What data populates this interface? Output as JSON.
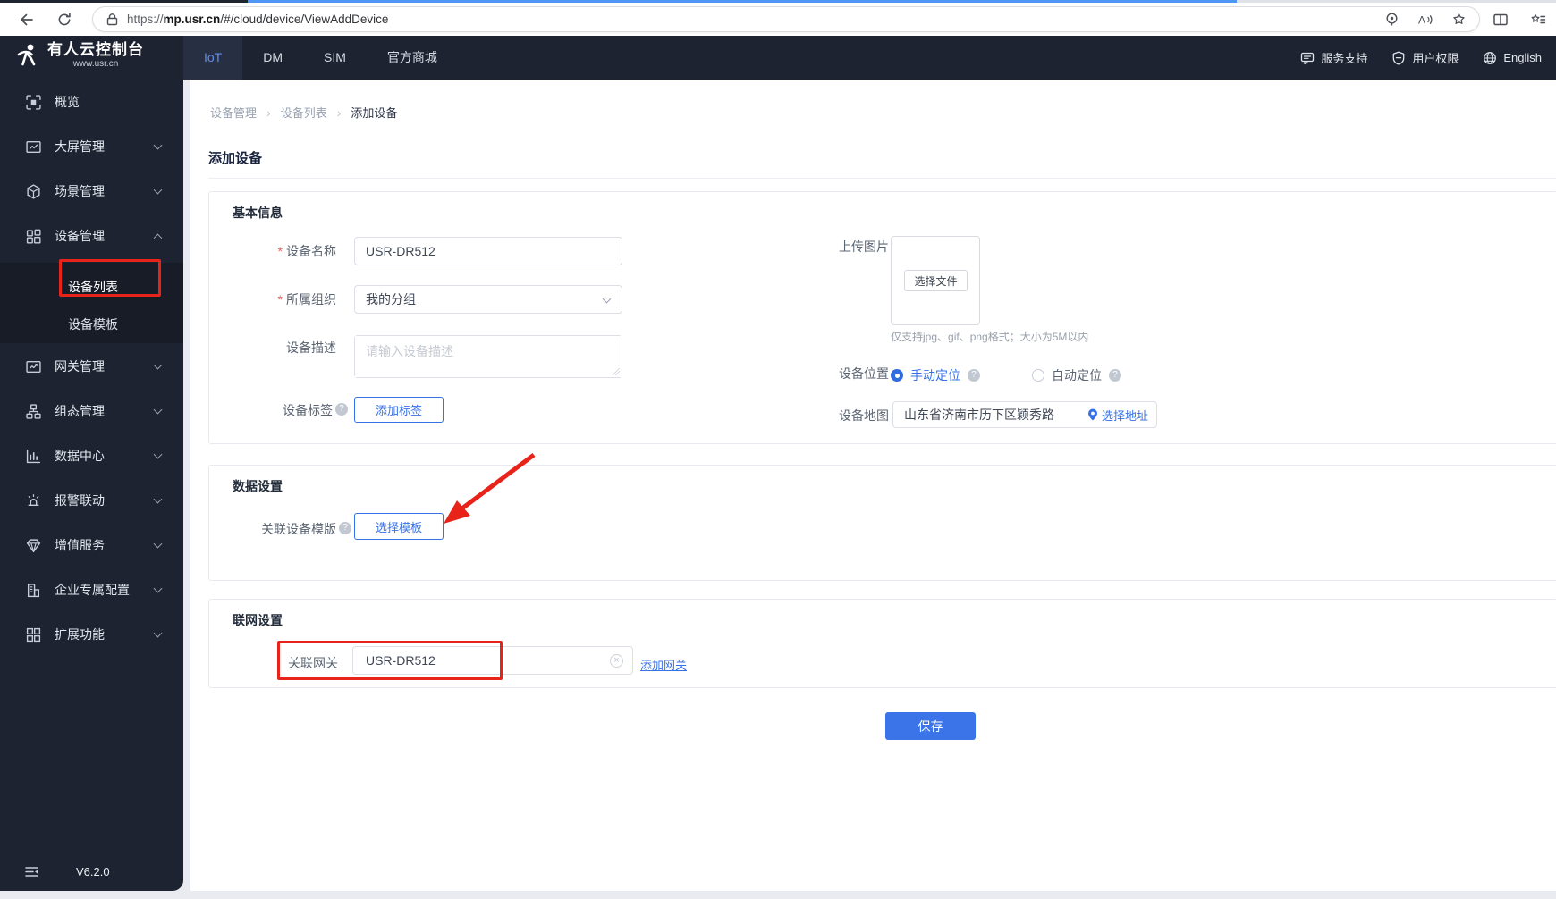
{
  "browser": {
    "url": {
      "scheme": "https://",
      "domain": "mp.usr.cn",
      "path": "/#/cloud/device/ViewAddDevice"
    }
  },
  "topnav": {
    "logo": {
      "title": "有人云控制台",
      "subtitle": "www.usr.cn"
    },
    "tabs": [
      {
        "label": "IoT",
        "active": true
      },
      {
        "label": "DM",
        "active": false
      },
      {
        "label": "SIM",
        "active": false
      },
      {
        "label": "官方商城",
        "active": false
      }
    ],
    "links": [
      {
        "label": "服务支持",
        "icon": "chat-icon"
      },
      {
        "label": "用户权限",
        "icon": "shield-icon"
      },
      {
        "label": "English",
        "icon": "globe-icon"
      }
    ]
  },
  "sidebar": {
    "items": [
      {
        "label": "概览",
        "icon": "overview-icon"
      },
      {
        "label": "大屏管理",
        "icon": "bigscreen-icon"
      },
      {
        "label": "场景管理",
        "icon": "scene-icon"
      },
      {
        "label": "设备管理",
        "icon": "device-icon",
        "expanded": true,
        "children": [
          {
            "label": "设备列表",
            "active": true
          },
          {
            "label": "设备模板",
            "active": false
          }
        ]
      },
      {
        "label": "网关管理",
        "icon": "gateway-icon"
      },
      {
        "label": "组态管理",
        "icon": "scada-icon"
      },
      {
        "label": "数据中心",
        "icon": "datacenter-icon"
      },
      {
        "label": "报警联动",
        "icon": "alarm-icon"
      },
      {
        "label": "增值服务",
        "icon": "vas-icon"
      },
      {
        "label": "企业专属配置",
        "icon": "enterprise-icon"
      },
      {
        "label": "扩展功能",
        "icon": "extension-icon"
      }
    ],
    "version": "V6.2.0"
  },
  "breadcrumb": {
    "items": [
      "设备管理",
      "设备列表",
      "添加设备"
    ],
    "separator": "›"
  },
  "page": {
    "title": "添加设备"
  },
  "form": {
    "basic": {
      "title": "基本信息",
      "device_name": {
        "label": "设备名称",
        "required": true,
        "value": "USR-DR512"
      },
      "organization": {
        "label": "所属组织",
        "required": true,
        "value": "我的分组"
      },
      "description": {
        "label": "设备描述",
        "placeholder": "请输入设备描述"
      },
      "tags": {
        "label": "设备标签",
        "button": "添加标签"
      },
      "upload": {
        "label": "上传图片",
        "button": "选择文件",
        "note": "仅支持jpg、gif、png格式；大小为5M以内"
      },
      "location": {
        "label": "设备位置",
        "options": [
          {
            "label": "手动定位",
            "selected": true
          },
          {
            "label": "自动定位",
            "selected": false
          }
        ]
      },
      "map": {
        "label": "设备地图",
        "value": "山东省济南市历下区颖秀路",
        "link": "选择地址"
      }
    },
    "data_settings": {
      "title": "数据设置",
      "template": {
        "label": "关联设备模版",
        "button": "选择模板"
      }
    },
    "network_settings": {
      "title": "联网设置",
      "gateway": {
        "label": "关联网关",
        "value": "USR-DR512",
        "link": "添加网关"
      }
    },
    "save": "保存"
  },
  "colors": {
    "accent": "#3671e8",
    "save_button": "#3a74e8",
    "annotation_red": "#e8231a",
    "sidebar_bg": "#1d2330"
  }
}
